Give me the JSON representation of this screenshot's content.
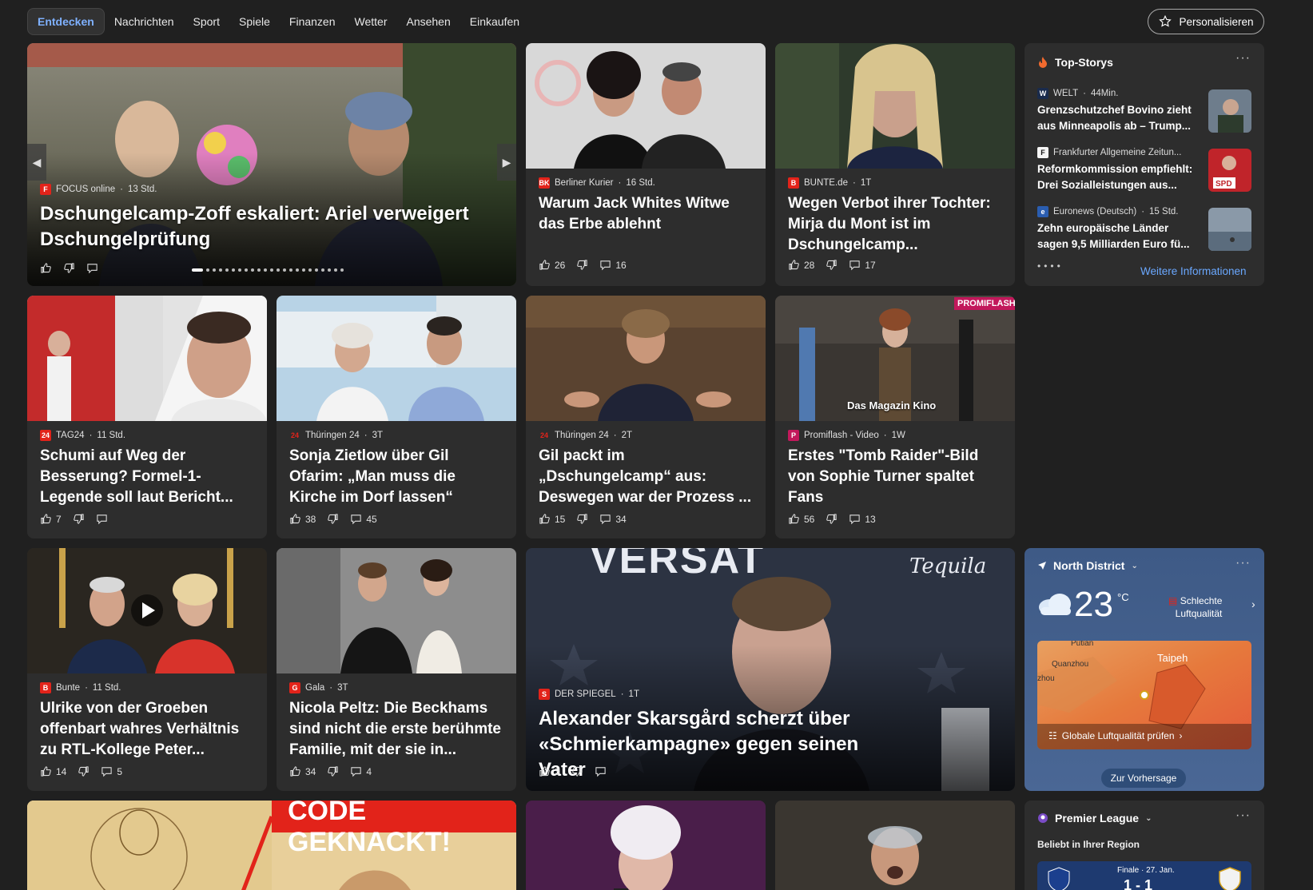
{
  "nav": {
    "tabs": [
      "Entdecken",
      "Nachrichten",
      "Sport",
      "Spiele",
      "Finanzen",
      "Wetter",
      "Ansehen",
      "Einkaufen"
    ],
    "personalize": "Personalisieren"
  },
  "hero": {
    "source": "FOCUS online",
    "time": "13 Std.",
    "headline": "Dschungelcamp-Zoff eskaliert: Ariel verweigert Dschungelprüfung"
  },
  "cards_row1": [
    {
      "source": "Berliner Kurier",
      "time": "16 Std.",
      "headline": "Warum Jack Whites Witwe das Erbe ablehnt",
      "likes": "26",
      "comments": "16",
      "logo_color": "#e2231a",
      "logo_text": "BK"
    },
    {
      "source": "BUNTE.de",
      "time": "1T",
      "headline": "Wegen Verbot ihrer Tochter: Mirja du Mont ist im Dschungelcamp...",
      "likes": "28",
      "comments": "17",
      "logo_color": "#e2231a",
      "logo_text": "B"
    }
  ],
  "top_stories": {
    "title": "Top-Storys",
    "items": [
      {
        "source": "WELT",
        "time": "44Min.",
        "headline": "Grenzschutzchef Bovino zieht aus Minneapolis ab – Trump...",
        "logo_text": "W",
        "logo_color": "#1a2b4c"
      },
      {
        "source": "Frankfurter Allgemeine Zeitun...",
        "time": "",
        "headline": "Reformkommission empfiehlt: Drei Sozialleistungen aus...",
        "logo_text": "F",
        "logo_color": "#f5f5f5"
      },
      {
        "source": "Euronews (Deutsch)",
        "time": "15 Std.",
        "headline": "Zehn europäische Länder sagen 9,5 Milliarden Euro fü...",
        "logo_text": "e",
        "logo_color": "#2a5db0"
      }
    ],
    "more": "Weitere Informationen"
  },
  "cards_row2": [
    {
      "source": "TAG24",
      "time": "11 Std.",
      "headline": "Schumi auf Weg der Besserung? Formel-1-Legende soll laut Bericht...",
      "likes": "7",
      "comments": "",
      "logo_color": "#e2231a",
      "logo_text": "24"
    },
    {
      "source": "Thüringen 24",
      "time": "3T",
      "headline": "Sonja Zietlow über Gil Ofarim: „Man muss die Kirche im Dorf lassen“",
      "likes": "38",
      "comments": "45",
      "logo_color": "#2d2d2d",
      "logo_text": "24"
    },
    {
      "source": "Thüringen 24",
      "time": "2T",
      "headline": "Gil packt im „Dschungelcamp“ aus: Deswegen war der Prozess ...",
      "likes": "15",
      "comments": "34",
      "logo_color": "#2d2d2d",
      "logo_text": "24"
    },
    {
      "source": "Promiflash - Video",
      "time": "1W",
      "headline": "Erstes \"Tomb Raider\"-Bild von Sophie Turner spaltet Fans",
      "likes": "56",
      "comments": "13",
      "logo_color": "#c2185b",
      "logo_text": "P"
    }
  ],
  "promiflash_badge": "PROMIFLASH",
  "kino_caption": "Das Magazin Kino",
  "cards_row3": [
    {
      "source": "Bunte",
      "time": "11 Std.",
      "headline": "Ulrike von der Groeben offenbart wahres Verhältnis zu RTL-Kollege Peter...",
      "likes": "14",
      "comments": "5",
      "logo_color": "#e2231a",
      "logo_text": "B"
    },
    {
      "source": "Gala",
      "time": "3T",
      "headline": "Nicola Peltz: Die Beckhams sind nicht die erste berühmte Familie, mit der sie in...",
      "likes": "34",
      "comments": "4",
      "logo_color": "#e2231a",
      "logo_text": "G"
    }
  ],
  "spiegel": {
    "source": "DER SPIEGEL",
    "time": "1T",
    "headline": "Alexander Skarsgård scherzt über «Schmierkampagne» gegen seinen Vater",
    "likes": "3",
    "comments": "",
    "bg_text_top": "VERSAT",
    "bg_text_right": "Tequila"
  },
  "weather": {
    "location": "North District",
    "temp": "23",
    "unit": "°C",
    "aq_line1": "Schlechte",
    "aq_line2": "Luftqualität",
    "map_labels": [
      "Putian",
      "Quanzhou",
      "zhou",
      "Taipeh"
    ],
    "aq_check": "Globale Luftqualität prüfen",
    "forecast": "Zur Vorhersage"
  },
  "code_banner": "CODE GEKNACKT!",
  "premier": {
    "title": "Premier League",
    "subtitle": "Beliebt in Ihrer Region",
    "match_label": "Finale · 27. Jan.",
    "score": "1 - 1"
  }
}
